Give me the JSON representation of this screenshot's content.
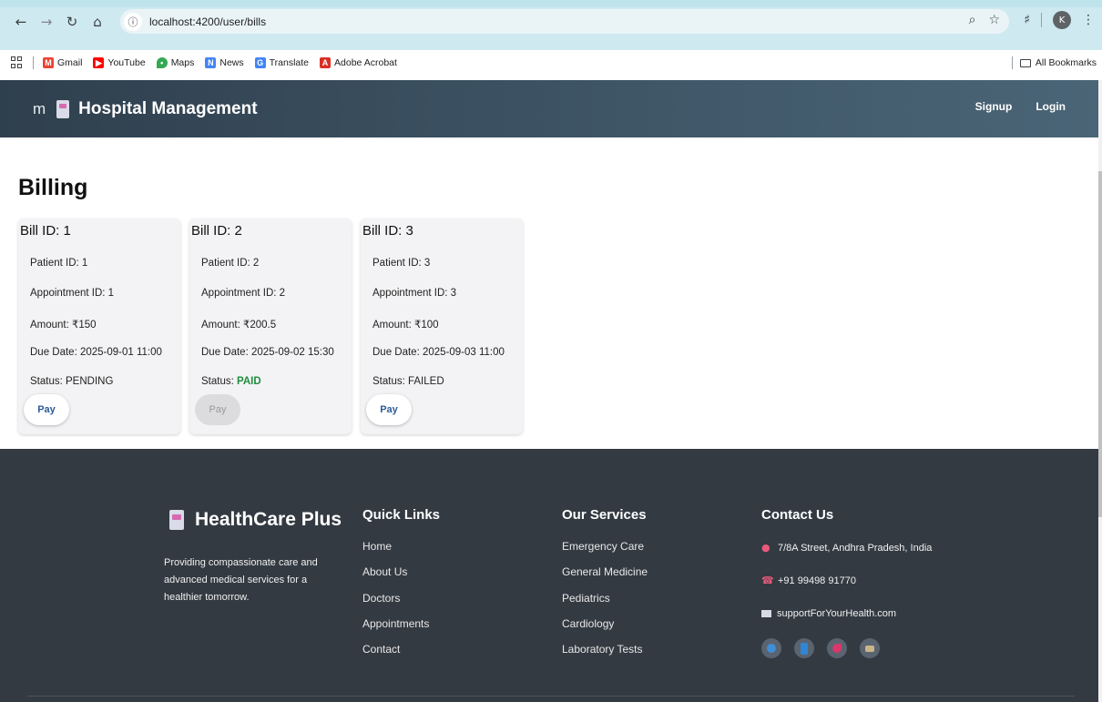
{
  "browser": {
    "url": "localhost:4200/user/bills",
    "profile_initial": "K",
    "bookmarks": [
      {
        "label": "Gmail",
        "icon": "gmail-icon",
        "color": "#ea4335"
      },
      {
        "label": "YouTube",
        "icon": "youtube-icon",
        "color": "#ff0000"
      },
      {
        "label": "Maps",
        "icon": "maps-icon",
        "color": "#34a853"
      },
      {
        "label": "News",
        "icon": "news-icon",
        "color": "#4285f4"
      },
      {
        "label": "Translate",
        "icon": "translate-icon",
        "color": "#4285f4"
      },
      {
        "label": "Adobe Acrobat",
        "icon": "acrobat-icon",
        "color": "#d93025"
      }
    ],
    "all_bookmarks": "All Bookmarks"
  },
  "header": {
    "menu_fragment": "m",
    "title": "Hospital Management",
    "signup": "Signup",
    "login": "Login"
  },
  "billing": {
    "title": "Billing",
    "bills": [
      {
        "id_label": "Bill ID: 1",
        "patient": "Patient ID: 1",
        "appointment": "Appointment ID: 1",
        "amount": "Amount: ₹150",
        "due": "Due Date: 2025-09-01 11:00",
        "status_prefix": "Status: ",
        "status": "PENDING",
        "pay": "Pay",
        "pay_enabled": true
      },
      {
        "id_label": "Bill ID: 2",
        "patient": "Patient ID: 2",
        "appointment": "Appointment ID: 2",
        "amount": "Amount: ₹200.5",
        "due": "Due Date: 2025-09-02 15:30",
        "status_prefix": "Status: ",
        "status": "PAID",
        "pay": "Pay",
        "pay_enabled": false
      },
      {
        "id_label": "Bill ID: 3",
        "patient": "Patient ID: 3",
        "appointment": "Appointment ID: 3",
        "amount": "Amount: ₹100",
        "due": "Due Date: 2025-09-03 11:00",
        "status_prefix": "Status: ",
        "status": "FAILED",
        "pay": "Pay",
        "pay_enabled": true
      }
    ]
  },
  "footer": {
    "brand": "HealthCare Plus",
    "tagline": "Providing compassionate care and advanced medical services for a healthier tomorrow.",
    "quick_links": {
      "title": "Quick Links",
      "items": [
        "Home",
        "About Us",
        "Doctors",
        "Appointments",
        "Contact"
      ]
    },
    "services": {
      "title": "Our Services",
      "items": [
        "Emergency Care",
        "General Medicine",
        "Pediatrics",
        "Cardiology",
        "Laboratory Tests"
      ]
    },
    "contact": {
      "title": "Contact Us",
      "address": "7/8A Street, Andhra Pradesh, India",
      "phone": "+91 99498 91770",
      "email": "supportForYourHealth.com"
    },
    "socials": [
      {
        "icon": "globe-icon",
        "color": "#3f8ed8"
      },
      {
        "icon": "book-icon",
        "color": "#2f86d6"
      },
      {
        "icon": "bird-icon",
        "color": "#d9386b"
      },
      {
        "icon": "hat-icon",
        "color": "#c9b48a"
      }
    ]
  }
}
